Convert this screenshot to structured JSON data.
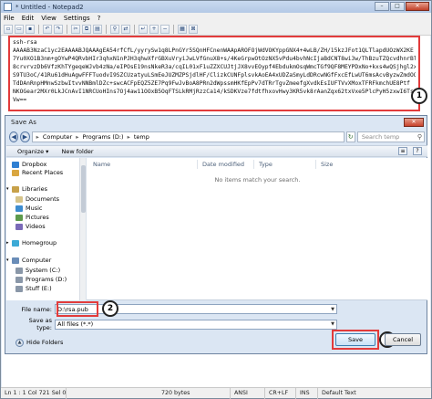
{
  "window": {
    "title": "* Untitled - Notepad2",
    "controls": {
      "minimize": "–",
      "maximize": "□",
      "close": "✕"
    }
  },
  "menu": [
    "File",
    "Edit",
    "View",
    "Settings",
    "?"
  ],
  "toolbar_icons": [
    "new-icon",
    "open-icon",
    "save-icon",
    "undo-icon",
    "redo-icon",
    "cut-icon",
    "copy-icon",
    "paste-icon",
    "find-icon",
    "replace-icon",
    "wordwrap-icon",
    "zoom-in-icon",
    "zoom-out-icon",
    "view-icon",
    "exit-icon"
  ],
  "editor": {
    "lines": [
      "ssh-rsa",
      "AAAAB3NzaC1yc2EAAAABJQAAAgEA54rfCfL/yyrySw1q8LPnGYr5SQnHFCnenWAApAROFOjWdVOKYppGNX4+4wLB/ZH/15kzJFot1QLTlapdUOzWX2KE",
      "7Yu0XO1B3nm+gOYwP4QRvbHIr3qhxN1nPJH3qhwXfrGBXuVryiJwLVfGnuX8+s/4KeGrpwOtOzNX5vPdu4bvhNcIjaBdCNT8wi3w/ThBzuTZQcvdhnrBlktz0s+tokYkrJ",
      "8crvrvzDb6VfzKhTYgeqeWJvb4zNa/eIPOsE19nsNkeR3a/cqIL01xF1uZZXCUJtjJX8vvEOypf4EbdukmOsqWmcTGf9QF8MEYPDxNo+kxs4wQSjhgl2xUDcZpaIb0Uk6MSk6hOo",
      "S9TU3oC/41Ru61dHuAgwFFFTuodvI9SZCUzatyuLSmEeJUZMZPSjdlHF/ClizkCUNFplsvkAoEA4xUDZaSmyLdDRcwNGfFxcEfLwUT6msAcvByzwZmdOQDRm2",
      "TdDAnRnpHMnwSzbwItvvNNBmlDZc+swcACFpEQZ5ZE7Pq9FwJvBoA8PRn2dWpssmHKfEpPv7dTRrTgvZmeefgXvdkEsIUFTVvXMoxTFRFkmchUE8Ptf",
      "NKOGear2MXr0LkJCnAvI1NRCUoHIns7Oj4aw11OOxB5OqFTSLkRMjRzzCa14/kSDKVze7fdtfhxovHwy3KR5vk8rAanZqx62txVxe5PlcPyH5zxwI6Ts8VZ",
      "Vw=="
    ],
    "callout_1": "1"
  },
  "status": {
    "position": "Ln 1 : 1",
    "col": "Col 721",
    "sel": "Sel 0",
    "size": "720 bytes",
    "encoding": "ANSI",
    "eol": "CR+LF",
    "mode": "INS",
    "scheme": "Default Text"
  },
  "dialog": {
    "title": "Save As",
    "close": "✕",
    "breadcrumb": [
      "Computer",
      "Programs (D:)",
      "temp"
    ],
    "search_placeholder": "Search temp",
    "organize": "Organize ▾",
    "new_folder": "New folder",
    "nav_items": [
      {
        "label": "Dropbox",
        "icon": "dropbox-icon",
        "color": "#2f7fd2"
      },
      {
        "label": "Recent Places",
        "icon": "recent-places-icon",
        "color": "#d9a640"
      },
      {
        "label": "Libraries",
        "icon": "libraries-icon",
        "color": "#c7a14a"
      },
      {
        "label": "Documents",
        "icon": "documents-icon",
        "color": "#d6c48a"
      },
      {
        "label": "Music",
        "icon": "music-icon",
        "color": "#3d8ccf"
      },
      {
        "label": "Pictures",
        "icon": "pictures-icon",
        "color": "#5d9a4c"
      },
      {
        "label": "Videos",
        "icon": "videos-icon",
        "color": "#7a6ab8"
      },
      {
        "label": "Homegroup",
        "icon": "homegroup-icon",
        "color": "#3caad6"
      },
      {
        "label": "Computer",
        "icon": "computer-icon",
        "color": "#6a8db8"
      },
      {
        "label": "System (C:)",
        "icon": "drive-c-icon",
        "color": "#8a97a8"
      },
      {
        "label": "Programs (D:)",
        "icon": "drive-d-icon",
        "color": "#8a97a8"
      },
      {
        "label": "Stuff (E:)",
        "icon": "drive-e-icon",
        "color": "#8a97a8"
      }
    ],
    "columns": [
      "Name",
      "Date modified",
      "Type",
      "Size"
    ],
    "empty_message": "No items match your search.",
    "file_name_label": "File name:",
    "file_name_value": "D:\\rsa.pub",
    "save_type_label": "Save as type:",
    "save_type_value": "All files (*.*)",
    "hide_folders": "Hide Folders",
    "save_button": "Save",
    "cancel_button": "Cancel",
    "callout_2": "2",
    "callout_3": "3"
  },
  "colors": {
    "highlight": "#e23b3b"
  }
}
